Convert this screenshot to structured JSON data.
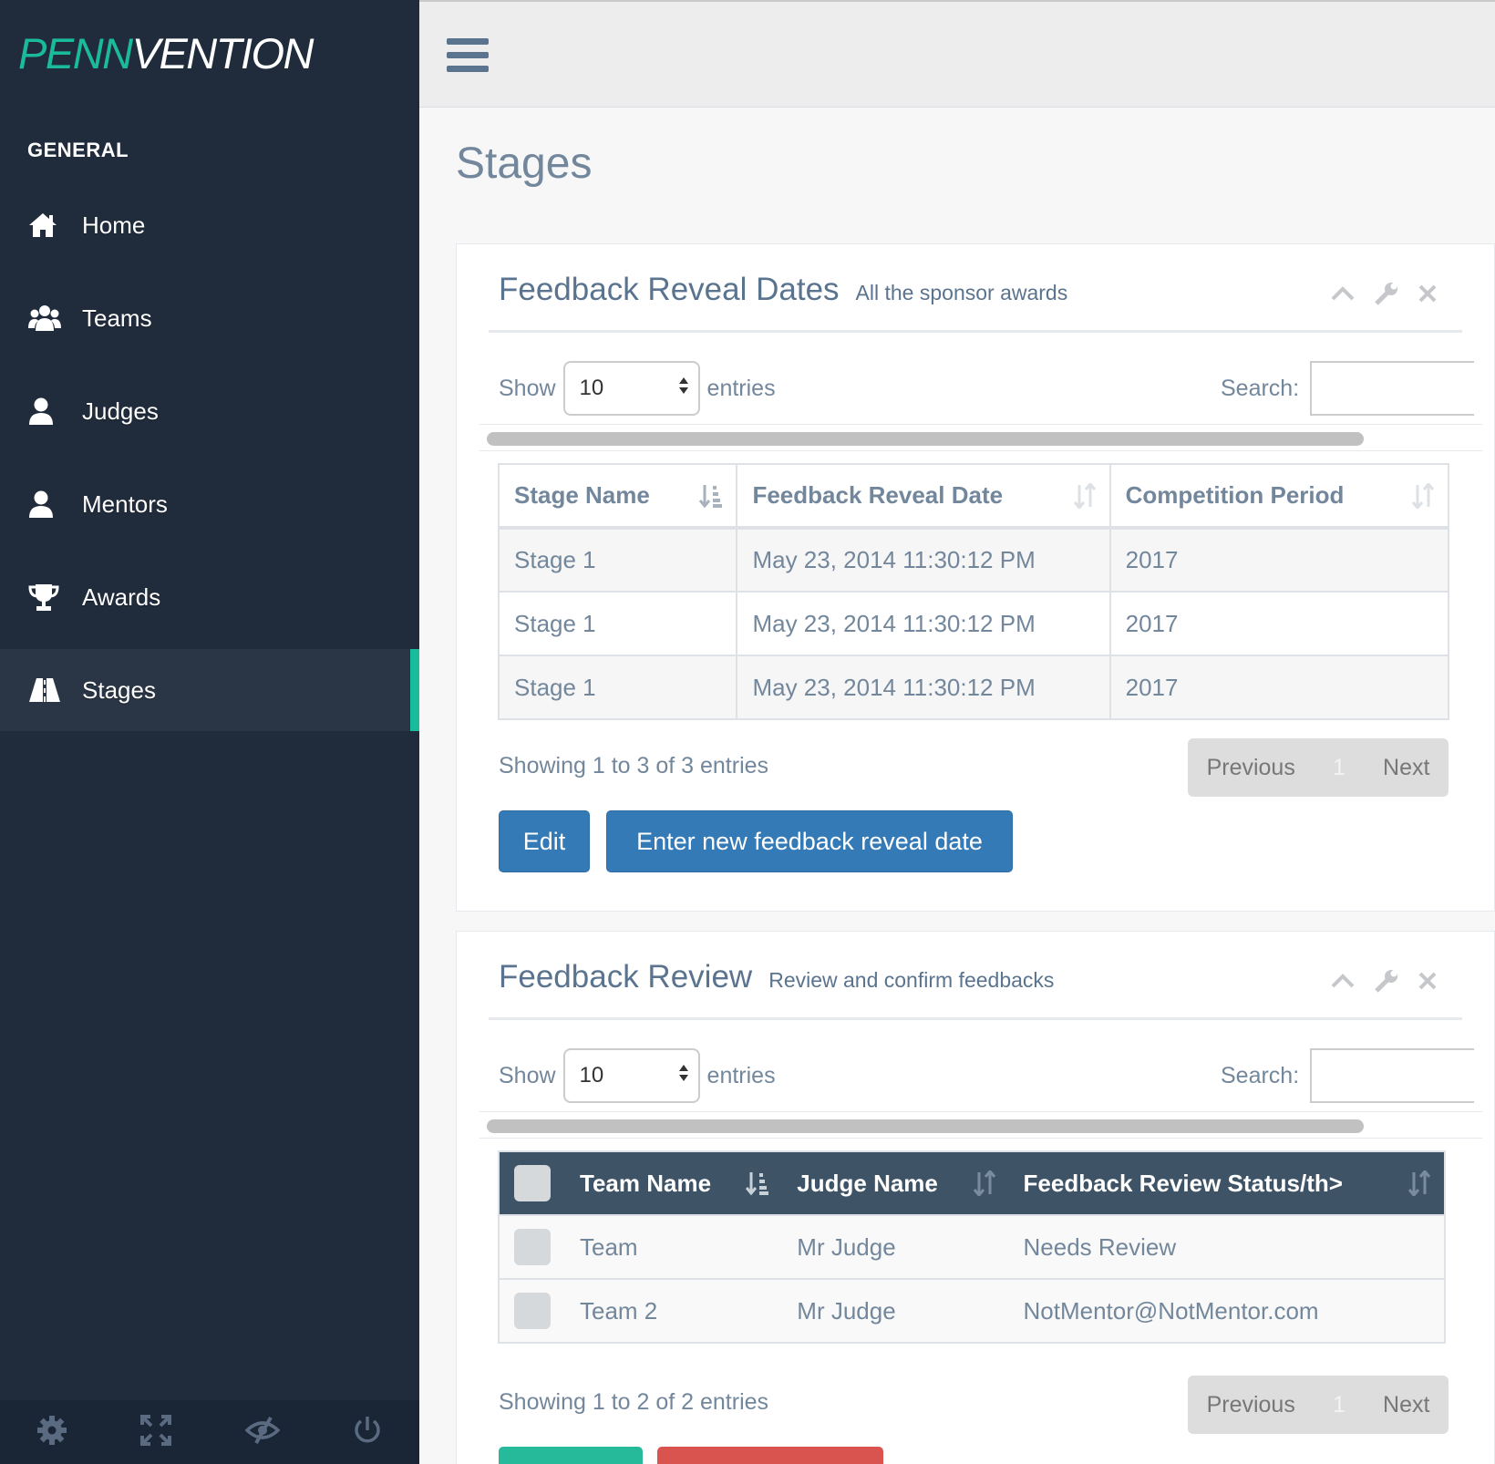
{
  "brand": {
    "part1": "PENN",
    "part2": "VENTION"
  },
  "sidebar": {
    "section_title": "GENERAL",
    "items": [
      {
        "label": "Home",
        "icon": "home-icon"
      },
      {
        "label": "Teams",
        "icon": "users-icon"
      },
      {
        "label": "Judges",
        "icon": "user-icon"
      },
      {
        "label": "Mentors",
        "icon": "user-icon"
      },
      {
        "label": "Awards",
        "icon": "trophy-icon"
      },
      {
        "label": "Stages",
        "icon": "road-icon",
        "active": true
      }
    ],
    "footer_icons": [
      "settings-icon",
      "fullscreen-icon",
      "eye-slash-icon",
      "power-icon"
    ]
  },
  "page": {
    "title": "Stages"
  },
  "panel1": {
    "title": "Feedback Reveal Dates",
    "subtitle": "All the sponsor awards",
    "show_label": "Show",
    "entries_label": "entries",
    "page_length": "10",
    "search_label": "Search:",
    "columns": [
      "Stage Name",
      "Feedback Reveal Date",
      "Competition Period"
    ],
    "rows": [
      [
        "Stage 1",
        "May 23, 2014 11:30:12 PM",
        "2017"
      ],
      [
        "Stage 1",
        "May 23, 2014 11:30:12 PM",
        "2017"
      ],
      [
        "Stage 1",
        "May 23, 2014 11:30:12 PM",
        "2017"
      ]
    ],
    "info": "Showing 1 to 3 of 3 entries",
    "pager": {
      "previous": "Previous",
      "page": "1",
      "next": "Next"
    },
    "buttons": {
      "edit": "Edit",
      "new": "Enter new feedback reveal date"
    }
  },
  "panel2": {
    "title": "Feedback Review",
    "subtitle": "Review and confirm feedbacks",
    "show_label": "Show",
    "entries_label": "entries",
    "page_length": "10",
    "search_label": "Search:",
    "columns": [
      "Team Name",
      "Judge Name",
      "Feedback Review Status/th>"
    ],
    "rows": [
      [
        "Team",
        "Mr Judge",
        "Needs Review"
      ],
      [
        "Team 2",
        "Mr Judge",
        "NotMentor@NotMentor.com"
      ]
    ],
    "info": "Showing 1 to 2 of 2 entries",
    "pager": {
      "previous": "Previous",
      "page": "1",
      "next": "Next"
    }
  },
  "colors": {
    "sidebar": "#202c3c",
    "accent": "#1abb9c",
    "primary": "#337ab7",
    "table_header": "#3f5367"
  }
}
